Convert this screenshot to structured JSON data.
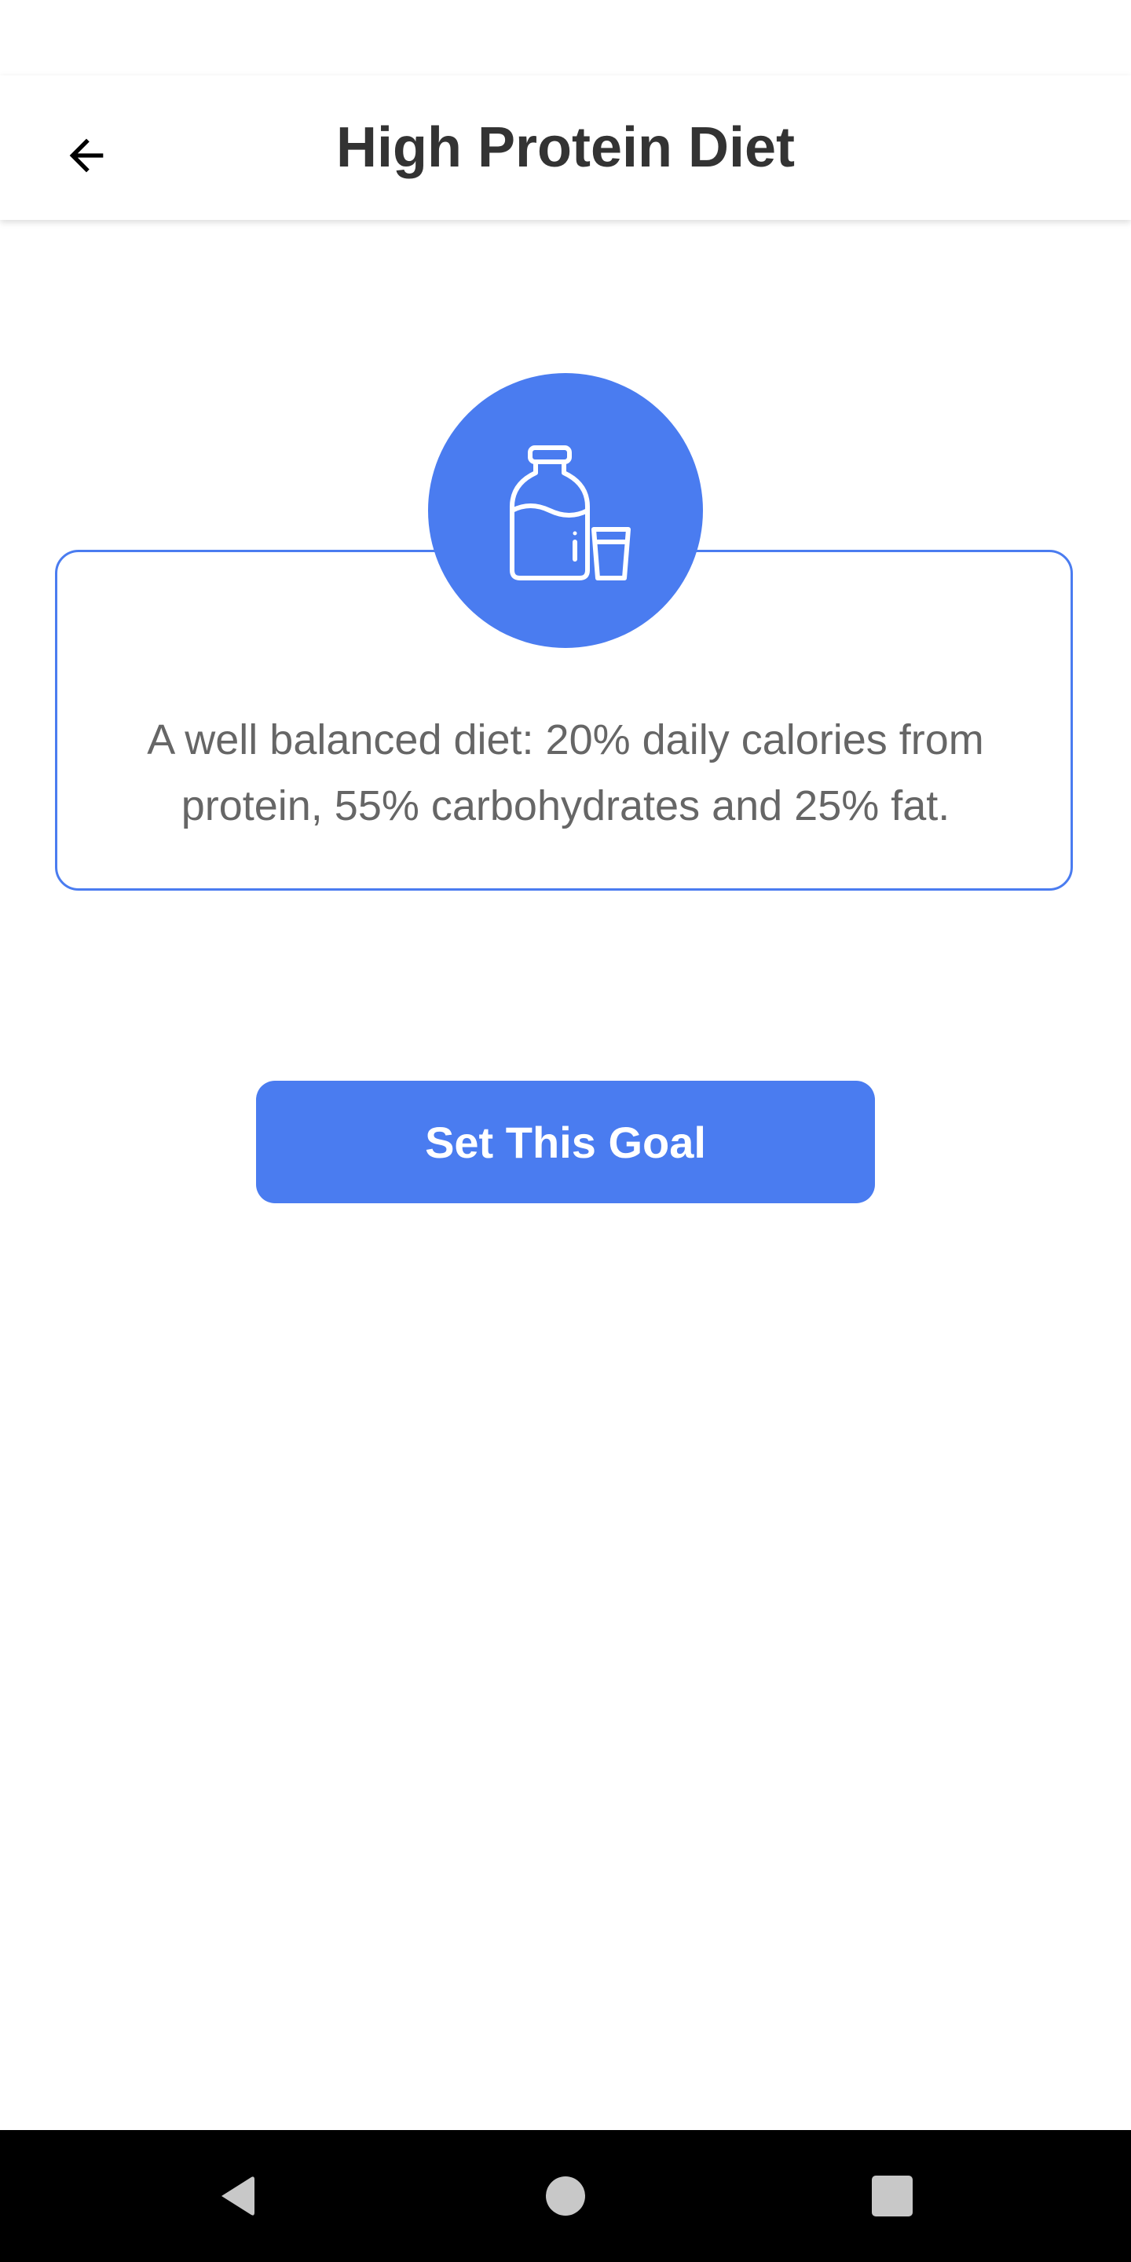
{
  "header": {
    "title": "High Protein Diet",
    "back_icon": "arrow-left-icon"
  },
  "card": {
    "icon": "milk-bottle-and-glass-icon",
    "description": "A well balanced diet: 20% daily calories from protein, 55% carbohydrates and 25% fat."
  },
  "actions": {
    "set_goal_label": "Set This Goal"
  },
  "system_nav": {
    "back_icon": "nav-back-triangle-icon",
    "home_icon": "nav-home-circle-icon",
    "recents_icon": "nav-recents-square-icon"
  },
  "colors": {
    "accent": "#4a7cf0",
    "title_text": "#333333",
    "body_text": "#666666",
    "nav_bar": "#000000",
    "nav_icon": "#c8c8c8"
  }
}
